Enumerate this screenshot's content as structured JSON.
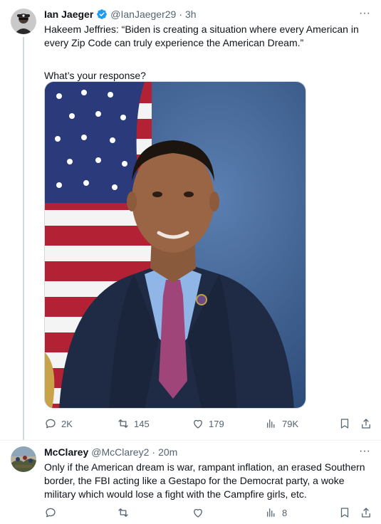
{
  "tweets": [
    {
      "author": {
        "name": "Ian Jaeger",
        "handle": "@IanJaeger29",
        "verified": true
      },
      "separator": "·",
      "time": "3h",
      "text_lines": [
        "Hakeem Jeffries: “Biden is creating a situation where every American in",
        "every Zip Code can truly experience the American Dream.”",
        "",
        "What’s your response?"
      ],
      "media": {
        "kind": "photo",
        "description_icon": "portrait-photo"
      },
      "stats": {
        "replies": "2K",
        "reposts": "145",
        "likes": "179",
        "views": "79K"
      }
    },
    {
      "author": {
        "name": "McClarey",
        "handle": "@McClarey2",
        "verified": false
      },
      "separator": "·",
      "time": "20m",
      "text_lines": [
        "Only if the American dream is war, rampant inflation, an erased Southern",
        "border, the FBI acting like a Gestapo for the Democrat party, a woke",
        "military which would lose a fight with the Campfire girls, etc."
      ],
      "stats": {
        "replies": "",
        "reposts": "",
        "likes": "",
        "views": "8"
      }
    }
  ],
  "more_glyph": "···",
  "colors": {
    "verified": "#1d9bf0",
    "secondary_text": "#536471",
    "border": "#cfd9de"
  }
}
